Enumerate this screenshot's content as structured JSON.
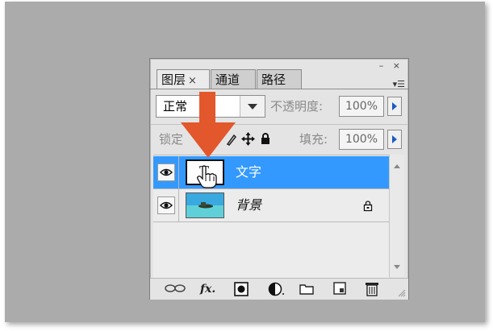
{
  "panel": {
    "tabs": [
      {
        "label": "图层",
        "close": "×",
        "active": true
      },
      {
        "label": "通道",
        "active": false
      },
      {
        "label": "路径",
        "active": false
      }
    ],
    "window_controls": "– ×",
    "blend_mode": "正常",
    "opacity_label": "不透明度:",
    "opacity_value": "100%",
    "lock_label": "锁定",
    "fill_label": "填充:",
    "fill_value": "100%"
  },
  "layers": [
    {
      "name": "文字",
      "type": "text",
      "selected": true,
      "thumb_label": "T"
    },
    {
      "name": "背景",
      "type": "image",
      "selected": false,
      "locked": true
    }
  ],
  "colors": {
    "canvas_bg": "#ababab",
    "selection": "#3399ff",
    "arrow": "#e2572b",
    "play_accent": "#1e5bbf"
  },
  "icons": {
    "eye": "eye-icon",
    "lock": "lock-icon",
    "move": "move-icon",
    "brush": "brush-icon",
    "arrow_annotation": "down-arrow-icon",
    "hand_cursor": "hand-cursor-icon"
  }
}
